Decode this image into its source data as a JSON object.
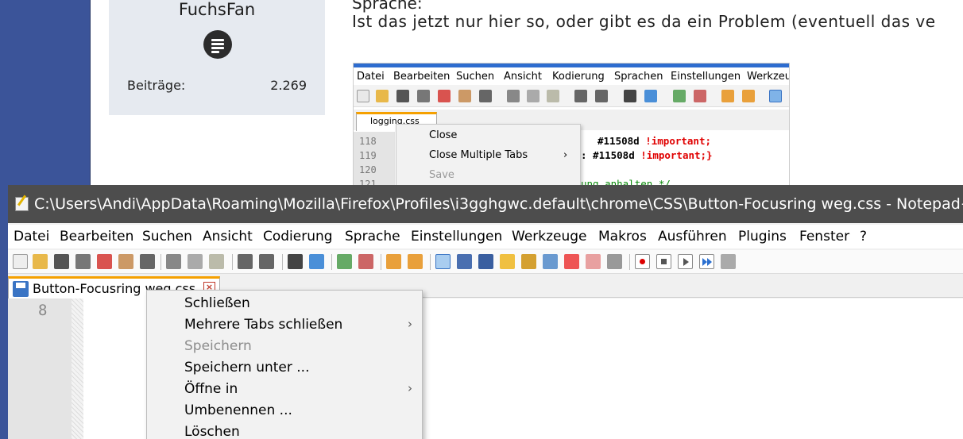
{
  "forum": {
    "user": {
      "name": "FuchsFan",
      "posts_label": "Beiträge:",
      "posts_value": "2.269"
    },
    "post": {
      "heading": "Sprache:",
      "text": "Ist das jetzt nur hier so, oder gibt es da ein Problem (eventuell das ve"
    }
  },
  "embedded_screenshot": {
    "menu": [
      "Datei",
      "Bearbeiten",
      "Suchen",
      "Ansicht",
      "Kodierung",
      "Sprachen",
      "Einstellungen",
      "Werkzeu"
    ],
    "tab_label": "logging.css",
    "line_numbers": [
      "118",
      "119",
      "120",
      "121"
    ],
    "code": {
      "line1_a": "#11508d ",
      "line1_b": "!important;",
      "line2_a": ":  #11508d ",
      "line2_b": "!important;}",
      "line4": "ung anhalten */"
    },
    "context_menu": {
      "close": "Close",
      "close_multiple": "Close Multiple Tabs",
      "save": "Save"
    }
  },
  "npp": {
    "title": "C:\\Users\\Andi\\AppData\\Roaming\\Mozilla\\Firefox\\Profiles\\i3gghgwc.default\\chrome\\CSS\\Button-Focusring weg.css - Notepad++",
    "menu": [
      "Datei",
      "Bearbeiten",
      "Suchen",
      "Ansicht",
      "Codierung",
      "Sprache",
      "Einstellungen",
      "Werkzeuge",
      "Makros",
      "Ausführen",
      "Plugins",
      "Fenster",
      "?"
    ],
    "tab_label": "Button-Focusring weg.css",
    "tab_close_glyph": "×",
    "line_number": "8",
    "context_menu": [
      {
        "label": "Schließen",
        "submenu": false,
        "disabled": false
      },
      {
        "label": "Mehrere Tabs schließen",
        "submenu": true,
        "disabled": false
      },
      {
        "label": "Speichern",
        "submenu": false,
        "disabled": true
      },
      {
        "label": "Speichern unter ...",
        "submenu": false,
        "disabled": false
      },
      {
        "label": "Öffne in",
        "submenu": true,
        "disabled": false
      },
      {
        "label": "Umbenennen ...",
        "submenu": false,
        "disabled": false
      },
      {
        "label": "Löschen",
        "submenu": false,
        "disabled": false
      }
    ],
    "submenu_arrow": "›"
  },
  "colors": {
    "desktop": "#3b5499",
    "titlebar": "#4d4d4d",
    "tab_accent": "#f5a000",
    "context_bg": "#f2f2f2"
  }
}
